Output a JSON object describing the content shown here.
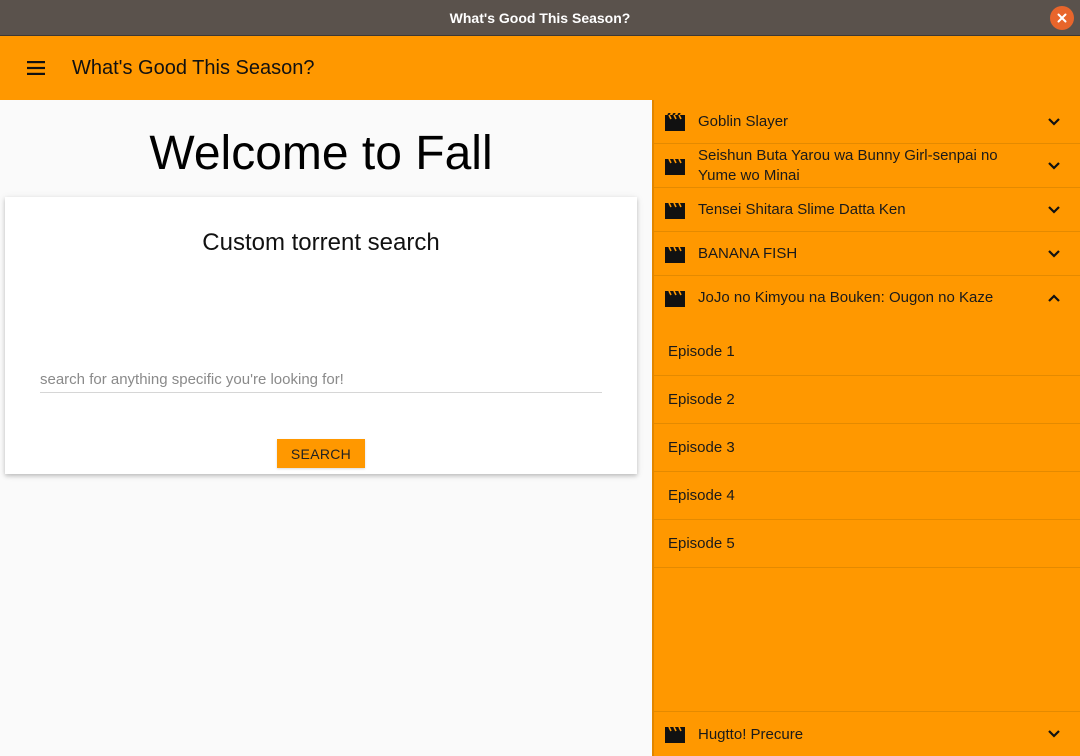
{
  "window": {
    "title": "What's Good This Season?"
  },
  "appbar": {
    "title": "What's Good This Season?"
  },
  "main": {
    "welcome": "Welcome to Fall",
    "search_card": {
      "title": "Custom torrent search",
      "placeholder": "search for anything specific you're looking for!",
      "button_label": "SEARCH"
    }
  },
  "shows": [
    {
      "title": "Goblin Slayer",
      "expanded": false
    },
    {
      "title": "Seishun Buta Yarou wa Bunny Girl-senpai no Yume wo Minai",
      "expanded": false
    },
    {
      "title": "Tensei Shitara Slime Datta Ken",
      "expanded": false
    },
    {
      "title": "BANANA FISH",
      "expanded": false
    },
    {
      "title": "JoJo no Kimyou na Bouken: Ougon no Kaze",
      "expanded": true
    }
  ],
  "episodes": [
    "Episode 1",
    "Episode 2",
    "Episode 3",
    "Episode 4",
    "Episode 5"
  ],
  "bottom_show": {
    "title": "Hugtto! Precure",
    "expanded": false
  },
  "icons": {
    "close": "close-icon",
    "menu": "hamburger-menu-icon",
    "show": "film-clapper-icon",
    "collapsed": "chevron-down-icon",
    "expanded": "chevron-up-icon"
  },
  "colors": {
    "accent": "#ff9800",
    "titlebar": "#5a524c",
    "close": "#e8652b"
  }
}
